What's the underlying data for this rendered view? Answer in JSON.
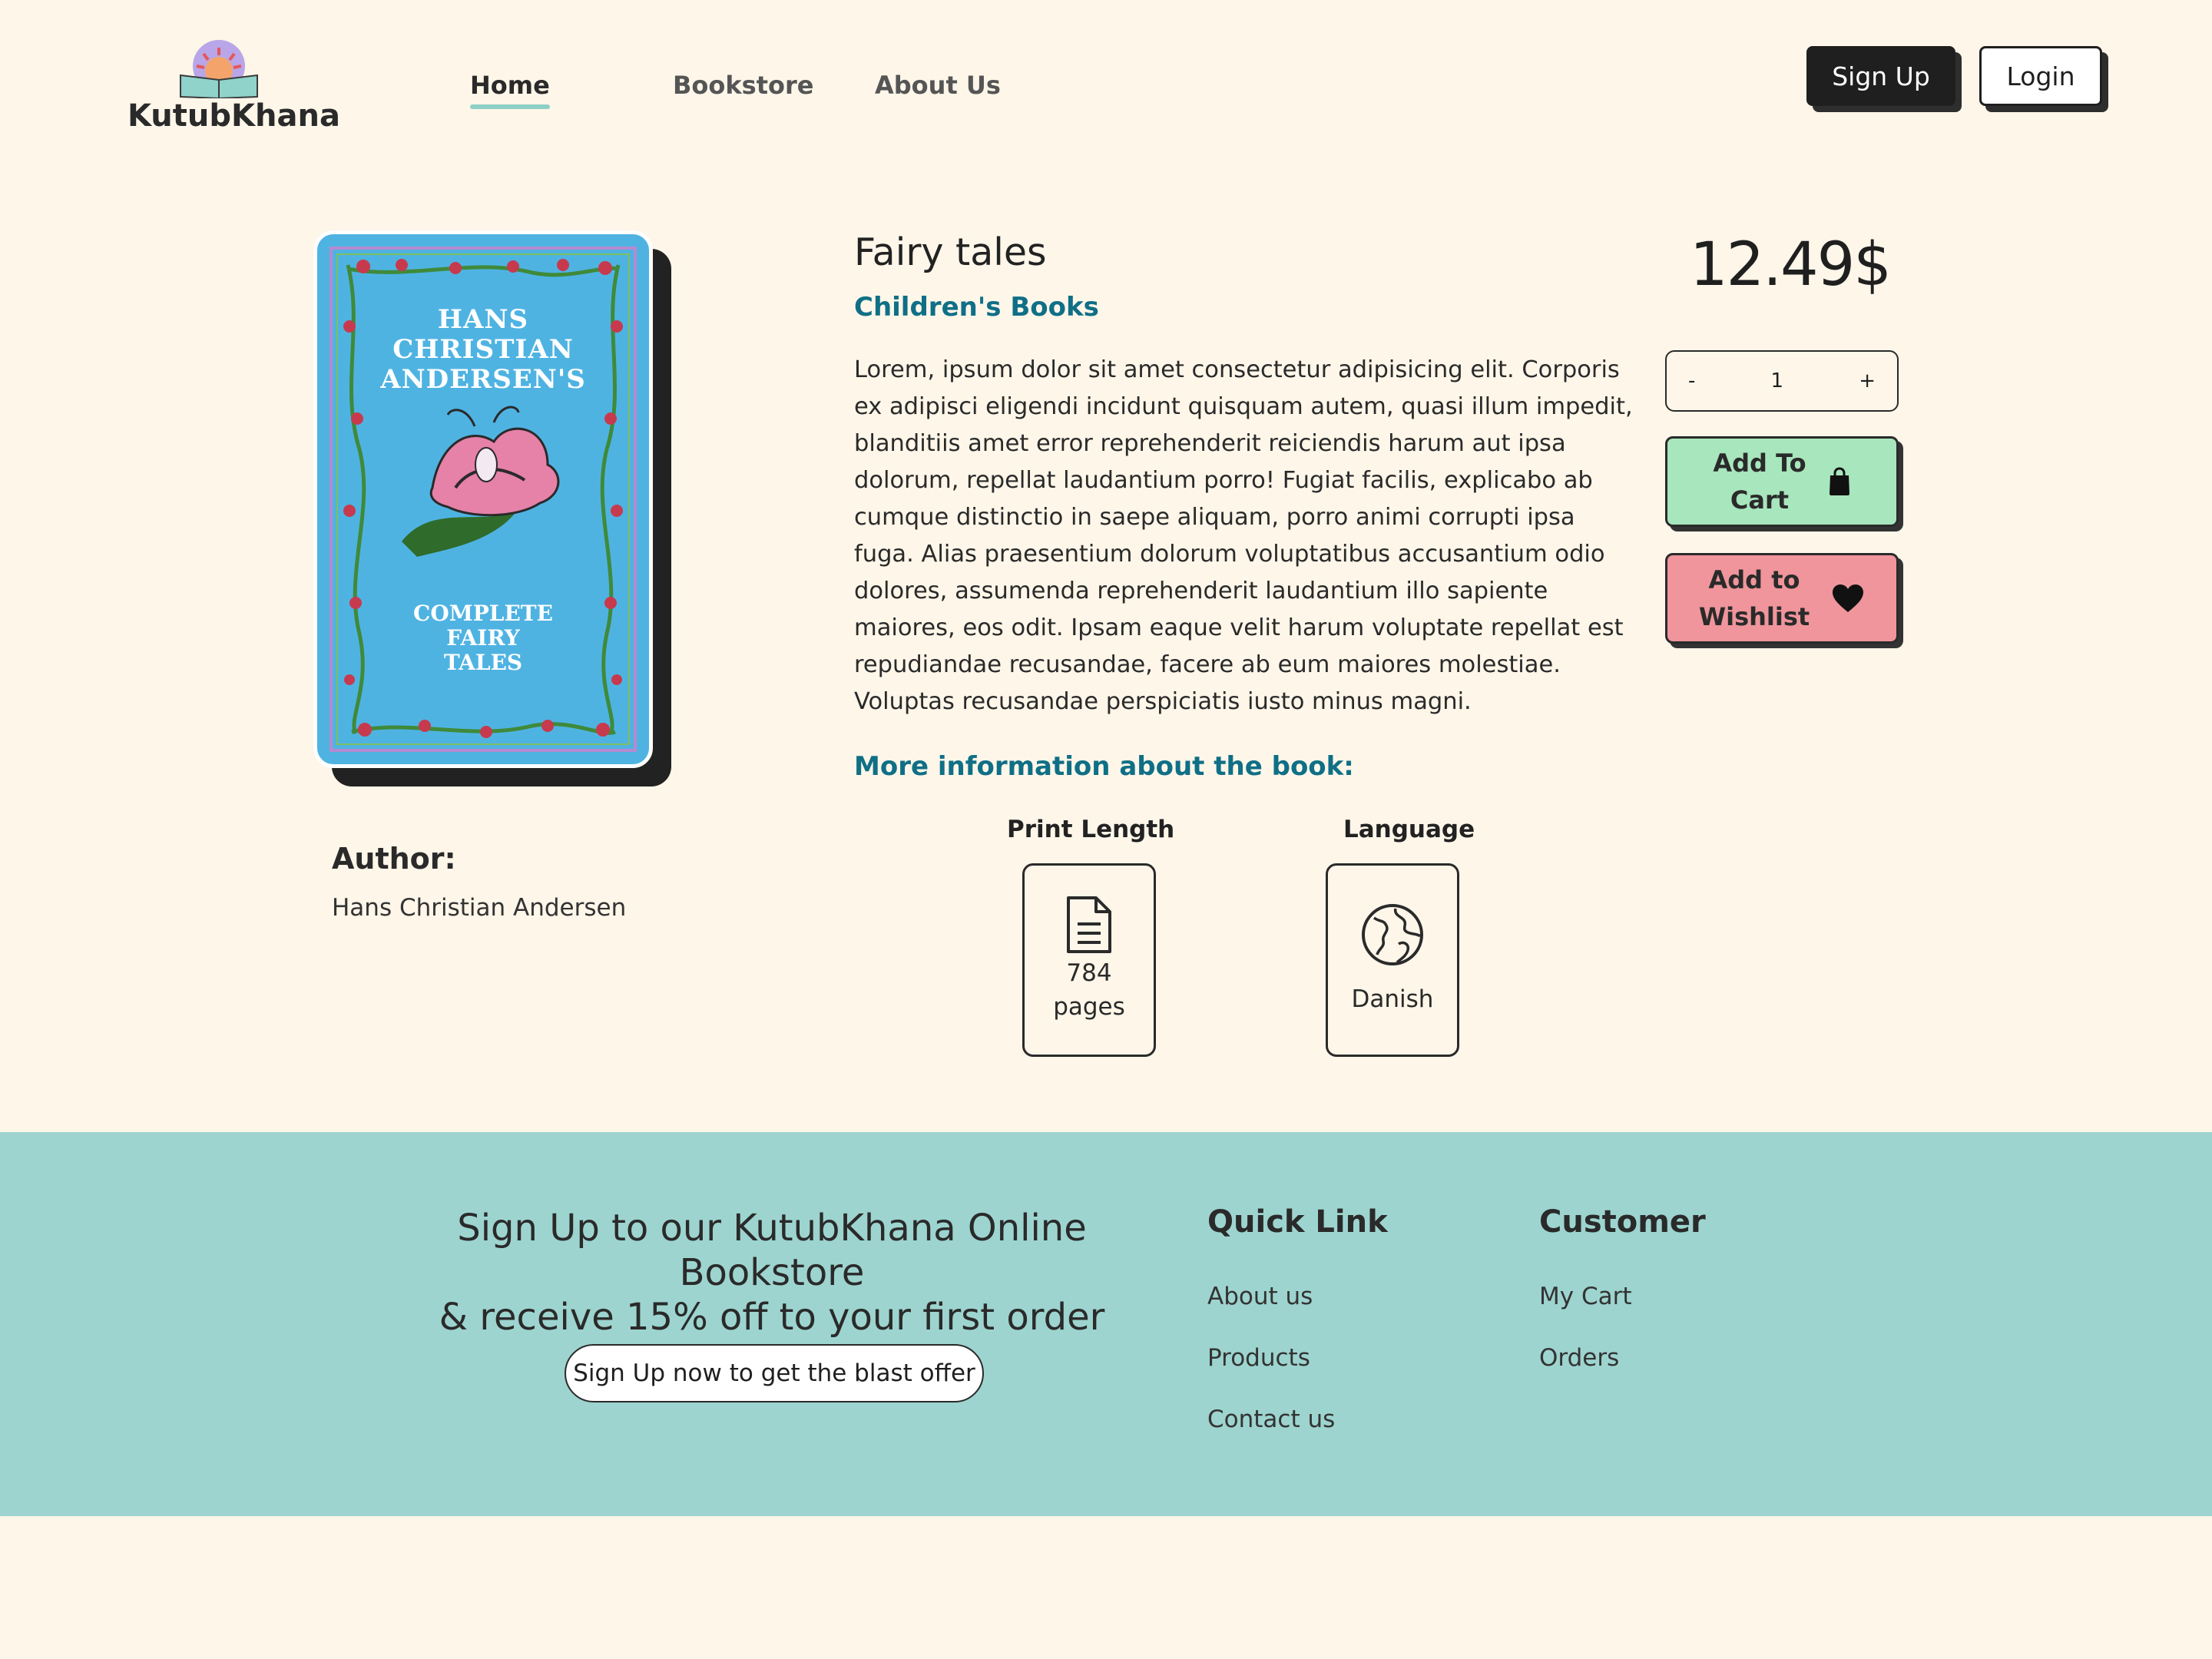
{
  "header": {
    "logo_text": "KutubKhana",
    "nav": {
      "home": "Home",
      "bookstore": "Bookstore",
      "about": "About Us"
    },
    "signup_label": "Sign Up",
    "login_label": "Login"
  },
  "cover": {
    "title_lines": "HANS CHRISTIAN ANDERSEN'S",
    "subtitle": "COMPLETE FAIRY TALES"
  },
  "author": {
    "label": "Author:",
    "name": "Hans Christian Andersen"
  },
  "book": {
    "title": "Fairy tales",
    "genre": "Children's Books",
    "description": "Lorem, ipsum dolor sit amet consectetur adipisicing elit. Corporis ex adipisci eligendi incidunt quisquam autem, quasi illum impedit, blanditiis amet error reprehenderit reiciendis harum aut ipsa dolorum, repellat laudantium porro! Fugiat facilis, explicabo ab cumque distinctio in saepe aliquam, porro animi corrupti ipsa fuga. Alias praesentium dolorum voluptatibus accusantium odio dolores, assumenda reprehenderit laudantium illo sapiente maiores, eos odit. Ipsam eaque velit harum voluptate repellat est repudiandae recusandae, facere ab eum maiores molestiae. Voluptas recusandae perspiciatis iusto minus magni.",
    "more_info_heading": "More information about the book:",
    "print_length": {
      "label": "Print Length",
      "value": "784",
      "unit": "pages",
      "icon": "document-icon"
    },
    "language": {
      "label": "Language",
      "value": "Danish",
      "icon": "globe-icon"
    }
  },
  "purchase": {
    "price": "12.49$",
    "quantity": {
      "minus": "-",
      "value": "1",
      "plus": "+"
    },
    "add_to_cart": {
      "line1": "Add To",
      "line2": "Cart",
      "icon": "shopping-bag-icon"
    },
    "add_to_wishlist": {
      "line1": "Add to",
      "line2": "Wishlist",
      "icon": "heart-icon"
    }
  },
  "footer": {
    "promo_line1": "Sign Up to our KutubKhana Online Bookstore",
    "promo_line2": "& receive 15% off to your first order",
    "promo_button": "Sign Up now to get the blast offer",
    "quick_link": {
      "heading": "Quick Link",
      "links": [
        "About us",
        "Products",
        "Contact us"
      ]
    },
    "customer": {
      "heading": "Customer",
      "links": [
        "My Cart",
        "Orders"
      ]
    }
  },
  "colors": {
    "background": "#fdf6e9",
    "accent_teal": "#0f6f86",
    "footer_bg": "#9dd4cf",
    "cart_green": "#a8e6bd",
    "wishlist_pink": "#ef959b",
    "cover_blue": "#4fb3e2"
  }
}
